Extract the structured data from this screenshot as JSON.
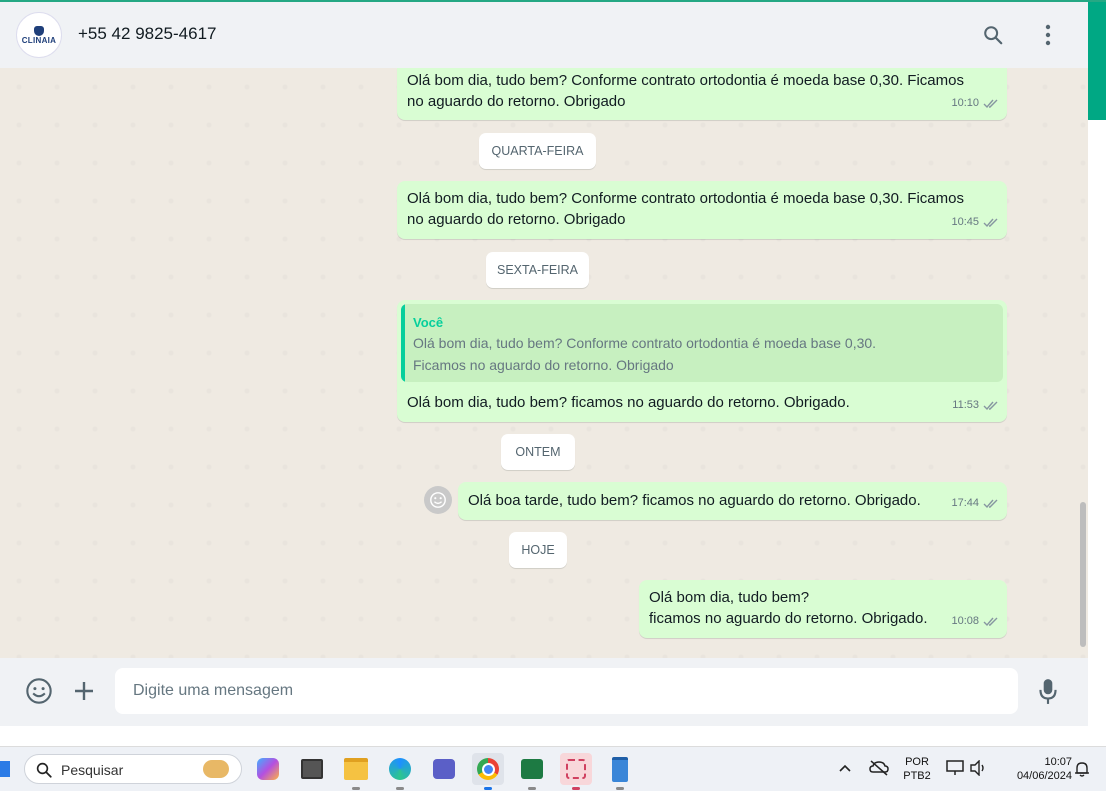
{
  "header": {
    "avatar_brand": "CLINAIA",
    "contact": "+55 42 9825-4617"
  },
  "messages": [
    {
      "text": "Olá bom dia, tudo bem? Conforme contrato ortodontia é moeda base 0,30. Ficamos\nno aguardo do retorno. Obrigado",
      "time": "10:10"
    },
    {
      "text": "Olá bom dia, tudo bem? Conforme contrato ortodontia é moeda base 0,30. Ficamos\nno aguardo do retorno. Obrigado",
      "time": "10:45"
    },
    {
      "text": "Olá bom dia, tudo bem? ficamos no aguardo do retorno. Obrigado.",
      "time": "11:53",
      "quote_author": "Você",
      "quote_text": "Olá bom dia, tudo bem? Conforme contrato ortodontia é moeda base 0,30.\nFicamos no aguardo do retorno. Obrigado"
    },
    {
      "text": "Olá boa tarde, tudo bem? ficamos no aguardo do retorno. Obrigado.",
      "time": "17:44"
    },
    {
      "text": "Olá bom dia, tudo bem?\nficamos no aguardo do retorno. Obrigado.",
      "time": "10:08"
    }
  ],
  "days": [
    "QUARTA-FEIRA",
    "SEXTA-FEIRA",
    "ONTEM",
    "HOJE"
  ],
  "composer": {
    "placeholder": "Digite uma mensagem"
  },
  "taskbar": {
    "search_label": "Pesquisar",
    "lang": "POR",
    "layout": "PTB2",
    "time": "10:07",
    "date": "04/06/2024"
  },
  "colors": {
    "accent": "#00a884",
    "outgoing_bubble": "#d9fdd3",
    "tick_read": "#8696a0"
  }
}
